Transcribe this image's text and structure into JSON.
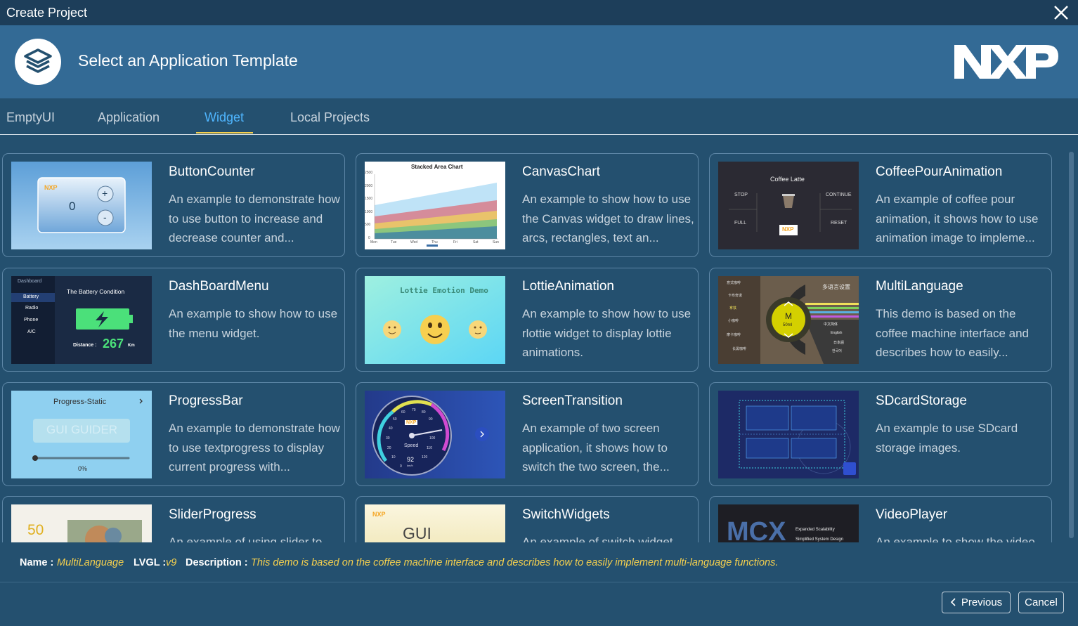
{
  "window": {
    "title": "Create Project"
  },
  "header": {
    "title": "Select an Application Template",
    "brand": "NXP"
  },
  "tabs": [
    {
      "label": "EmptyUI"
    },
    {
      "label": "Application"
    },
    {
      "label": "Widget"
    },
    {
      "label": "Local Projects"
    }
  ],
  "active_tab": "Widget",
  "templates": [
    {
      "name": "ButtonCounter",
      "desc": "An example to demonstrate how to use button to increase and decrease counter and...",
      "thumb": {
        "counter": "0",
        "plus": "+",
        "minus": "-",
        "logo": "NXP"
      }
    },
    {
      "name": "CanvasChart",
      "desc": "An example to show how to use the Canvas widget to draw lines, arcs, rectangles, text an...",
      "thumb": {
        "title": "Stacked Area Chart",
        "y_ticks": [
          "2500",
          "2000",
          "1500",
          "1000",
          "500",
          "0"
        ],
        "x_ticks": [
          "Mon",
          "Tue",
          "Wed",
          "Thu",
          "Fri",
          "Sat",
          "Sun"
        ]
      }
    },
    {
      "name": "CoffeePourAnimation",
      "desc": "An example of coffee pour animation, it shows how to use animation image to impleme...",
      "thumb": {
        "title": "Coffee Latte",
        "stop": "STOP",
        "continue": "CONTINUE",
        "full": "FULL",
        "reset": "RESET",
        "logo": "NXP"
      }
    },
    {
      "name": "DashBoardMenu",
      "desc": "An example to show how to use the menu widget.",
      "thumb": {
        "header": "Dashboard",
        "menu": [
          "Battery",
          "Radio",
          "Phone",
          "A/C"
        ],
        "title": "The Battery Condition",
        "distance_label": "Distance :",
        "distance_value": "267",
        "unit": "Km"
      }
    },
    {
      "name": "LottieAnimation",
      "desc": "An example to show how to use rlottie widget to display lottie animations.",
      "thumb": {
        "title": "Lottie Emotion Demo"
      }
    },
    {
      "name": "MultiLanguage",
      "desc": "This demo is based on the coffee machine interface and describes how to easily...",
      "thumb": {
        "size": "M",
        "volume": "50ml",
        "title": "多语言设置",
        "items": [
          "意式咖啡",
          "卡布奇诺",
          "拿铁",
          "小咖啡",
          "摩卡咖啡",
          "长黑咖啡"
        ],
        "languages": [
          "中文简体",
          "English",
          "日本語",
          "한국어"
        ]
      }
    },
    {
      "name": "ProgressBar",
      "desc": "An example to demonstrate how to use textprogress to display current progress with...",
      "thumb": {
        "title": "Progress-Static",
        "button": "GUI GUIDER",
        "percent": "0%"
      }
    },
    {
      "name": "ScreenTransition",
      "desc": "An example of two screen application, it shows how to switch the two screen, the...",
      "thumb": {
        "speed_label": "Speed",
        "speed_value": "92",
        "unit": "km/h",
        "logo": "NXP",
        "ticks": [
          "0",
          "10",
          "20",
          "30",
          "40",
          "50",
          "60",
          "70",
          "80",
          "90",
          "100",
          "110",
          "120"
        ]
      }
    },
    {
      "name": "SDcardStorage",
      "desc": "An example to use SDcard storage images.",
      "thumb": {}
    },
    {
      "name": "SliderProgress",
      "desc": "An example of using slider to...",
      "thumb": {
        "value": "50"
      }
    },
    {
      "name": "SwitchWidgets",
      "desc": "An example of switch widget...",
      "thumb": {
        "logo": "NXP",
        "text": "GUI"
      }
    },
    {
      "name": "VideoPlayer",
      "desc": "An example to show the video...",
      "thumb": {
        "text": "MCX",
        "line1": "Expanded Scalability",
        "line2": "Simplified System Design"
      }
    }
  ],
  "info": {
    "name_label": "Name :",
    "name_value": "MultiLanguage",
    "lvgl_label": "LVGL :",
    "lvgl_value": "v9",
    "desc_label": "Description :",
    "desc_value": "This demo is based on the coffee machine interface and describes how to easily implement multi-language functions."
  },
  "buttons": {
    "previous": "Previous",
    "cancel": "Cancel"
  },
  "colors": {
    "accent": "#4fb6ff",
    "highlight": "#f5d04e",
    "background": "#24506f",
    "header": "#336a95"
  }
}
